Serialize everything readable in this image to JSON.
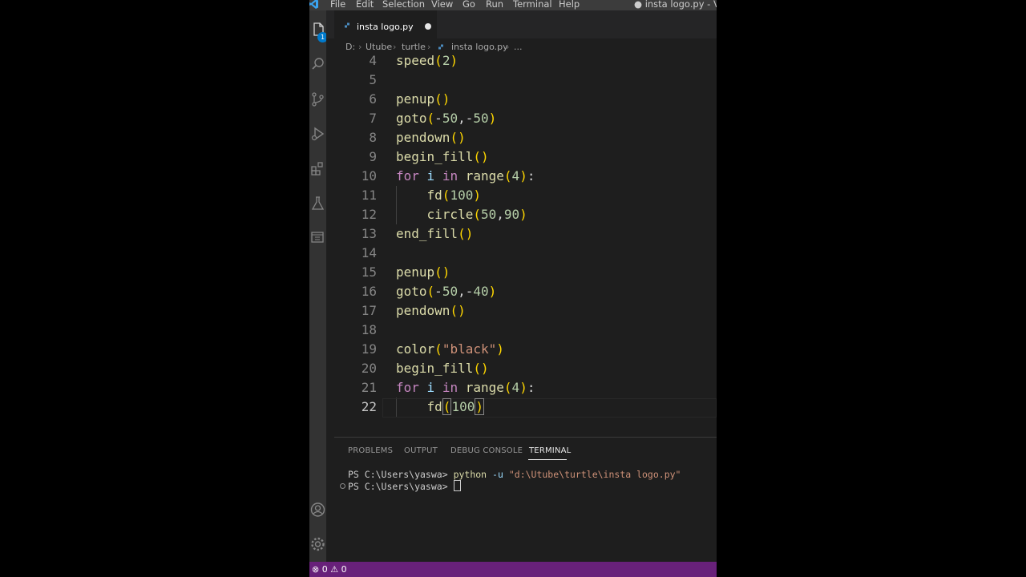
{
  "menu": {
    "items": [
      "File",
      "Edit",
      "Selection",
      "View",
      "Go",
      "Run",
      "Terminal",
      "Help"
    ],
    "window_title": "● insta logo.py - Visua"
  },
  "activity_bar": {
    "explorer_badge": "1",
    "icons": [
      "files-icon",
      "search-icon",
      "source-control-icon",
      "run-debug-icon",
      "extensions-icon",
      "testing-icon",
      "remote-explorer-icon",
      "account-icon",
      "manage-gear-icon"
    ]
  },
  "tab": {
    "label": "insta logo.py",
    "dirty": true
  },
  "breadcrumb": {
    "drive": "D:",
    "folder1": "Utube",
    "folder2": "turtle",
    "file": "insta logo.py",
    "more": "..."
  },
  "editor": {
    "current_line": 22,
    "lines": [
      {
        "n": "4",
        "text": "speed(2)"
      },
      {
        "n": "5",
        "text": ""
      },
      {
        "n": "6",
        "text": "penup()"
      },
      {
        "n": "7",
        "text": "goto(-50,-50)"
      },
      {
        "n": "8",
        "text": "pendown()"
      },
      {
        "n": "9",
        "text": "begin_fill()"
      },
      {
        "n": "10",
        "text": "for i in range(4):"
      },
      {
        "n": "11",
        "text": "    fd(100)"
      },
      {
        "n": "12",
        "text": "    circle(50,90)"
      },
      {
        "n": "13",
        "text": "end_fill()"
      },
      {
        "n": "14",
        "text": ""
      },
      {
        "n": "15",
        "text": "penup()"
      },
      {
        "n": "16",
        "text": "goto(-50,-40)"
      },
      {
        "n": "17",
        "text": "pendown()"
      },
      {
        "n": "18",
        "text": ""
      },
      {
        "n": "19",
        "text": "color(\"black\")"
      },
      {
        "n": "20",
        "text": "begin_fill()"
      },
      {
        "n": "21",
        "text": "for i in range(4):"
      },
      {
        "n": "22",
        "text": "    fd(100)"
      }
    ]
  },
  "panel": {
    "tabs": [
      "PROBLEMS",
      "OUTPUT",
      "DEBUG CONSOLE",
      "TERMINAL"
    ],
    "active_tab": "TERMINAL",
    "terminal": {
      "prompt": "PS C:\\Users\\yaswa> ",
      "command": "python",
      "flag": "-u",
      "arg": "\"d:\\Utube\\turtle\\insta logo.py\""
    }
  },
  "status": {
    "errors": "0",
    "warnings": "0",
    "bar_color": "#68217a"
  }
}
